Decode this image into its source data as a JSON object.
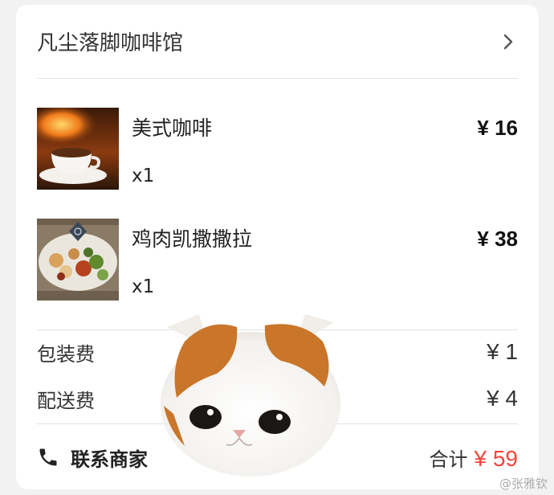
{
  "shop": {
    "name": "凡尘落脚咖啡馆"
  },
  "items": [
    {
      "name": "美式咖啡",
      "qty": "x1",
      "price": "¥ 16",
      "image": "coffee-cup-photo"
    },
    {
      "name": "鸡肉凯撒撒拉",
      "qty": "x1",
      "price": "¥ 38",
      "image": "salad-bowl-photo"
    }
  ],
  "fees": [
    {
      "label": "包装费",
      "value": "¥ 1"
    },
    {
      "label": "配送费",
      "value": "¥ 4"
    }
  ],
  "footer": {
    "contact_label": "联系商家",
    "total_label": "合计",
    "total_value": "¥ 59"
  },
  "overlay": {
    "image": "kitten-face-sticker"
  },
  "watermark": {
    "text": "@张雅钦"
  },
  "colors": {
    "accent": "#f5453b",
    "background": "#f2f2f2",
    "card": "#ffffff"
  }
}
